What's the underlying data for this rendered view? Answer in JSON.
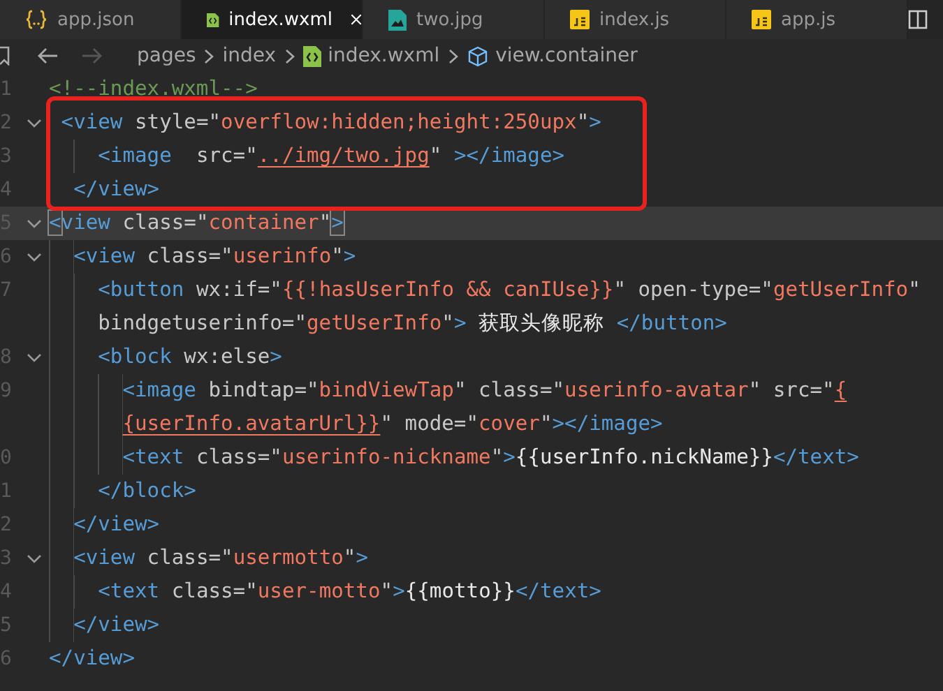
{
  "tabs": [
    {
      "label": "app.json",
      "kind": "json",
      "selected": false
    },
    {
      "label": "index.wxml",
      "kind": "wxml",
      "selected": true
    },
    {
      "label": "two.jpg",
      "kind": "image",
      "selected": false
    },
    {
      "label": "index.js",
      "kind": "js",
      "selected": false
    },
    {
      "label": "app.js",
      "kind": "js",
      "selected": false
    }
  ],
  "breadcrumb": [
    {
      "label": "pages",
      "kind": "folder"
    },
    {
      "label": "index",
      "kind": "folder"
    },
    {
      "label": "index.wxml",
      "kind": "wxml"
    },
    {
      "label": "view.container",
      "kind": "element"
    }
  ],
  "rows": [
    {
      "number": "1",
      "fold": false,
      "boxed": false,
      "current": false,
      "tokens": [
        {
          "kind": "c",
          "t": "<!--index.wxml-->"
        }
      ]
    },
    {
      "number": "2",
      "fold": true,
      "boxed": true,
      "current": false,
      "tokens": [
        {
          "kind": "t",
          "t": " <view"
        },
        {
          "kind": "a",
          "t": " style=\""
        },
        {
          "kind": "s",
          "t": "overflow:hidden;height:250upx"
        },
        {
          "kind": "a",
          "t": "\""
        },
        {
          "kind": "t",
          "t": ">"
        }
      ]
    },
    {
      "number": "3",
      "fold": false,
      "boxed": true,
      "current": false,
      "tokens": [
        {
          "kind": "t",
          "t": "    <image"
        },
        {
          "kind": "a",
          "t": "  src=\""
        },
        {
          "kind": "s",
          "t": "../img/two.jpg",
          "u": true
        },
        {
          "kind": "a",
          "t": "\" "
        },
        {
          "kind": "t",
          "t": "></image>"
        }
      ]
    },
    {
      "number": "4",
      "fold": false,
      "boxed": true,
      "current": false,
      "tokens": [
        {
          "kind": "t",
          "t": "  </view>"
        }
      ]
    },
    {
      "number": "5",
      "fold": true,
      "boxed": false,
      "current": true,
      "tokens": [
        {
          "kind": "t",
          "t": "<",
          "m": true
        },
        {
          "kind": "t",
          "t": "view"
        },
        {
          "kind": "a",
          "t": " class=\""
        },
        {
          "kind": "s",
          "t": "container"
        },
        {
          "kind": "a",
          "t": "\""
        },
        {
          "kind": "t",
          "t": ">",
          "m": true
        }
      ]
    },
    {
      "number": "6",
      "fold": true,
      "boxed": false,
      "current": false,
      "tokens": [
        {
          "kind": "t",
          "t": "  <view"
        },
        {
          "kind": "a",
          "t": " class=\""
        },
        {
          "kind": "s",
          "t": "userinfo"
        },
        {
          "kind": "a",
          "t": "\""
        },
        {
          "kind": "t",
          "t": ">"
        }
      ]
    },
    {
      "number": "7",
      "fold": false,
      "boxed": false,
      "current": false,
      "tokens": [
        {
          "kind": "t",
          "t": "    <button"
        },
        {
          "kind": "a",
          "t": " wx:if=\""
        },
        {
          "kind": "s",
          "t": "{{!hasUserInfo && canIUse}}"
        },
        {
          "kind": "a",
          "t": "\" open-type=\""
        },
        {
          "kind": "s",
          "t": "getUserInfo"
        },
        {
          "kind": "a",
          "t": "\""
        }
      ]
    },
    {
      "number": "",
      "fold": false,
      "boxed": false,
      "current": false,
      "tokens": [
        {
          "kind": "a",
          "t": "    bindgetuserinfo=\""
        },
        {
          "kind": "s",
          "t": "getUserInfo"
        },
        {
          "kind": "a",
          "t": "\""
        },
        {
          "kind": "t",
          "t": ">"
        },
        {
          "kind": "x",
          "t": " 获取头像昵称 "
        },
        {
          "kind": "t",
          "t": "</button>"
        }
      ]
    },
    {
      "number": "8",
      "fold": true,
      "boxed": false,
      "current": false,
      "tokens": [
        {
          "kind": "t",
          "t": "    <block"
        },
        {
          "kind": "a",
          "t": " wx:else"
        },
        {
          "kind": "t",
          "t": ">"
        }
      ]
    },
    {
      "number": "9",
      "fold": false,
      "boxed": false,
      "current": false,
      "tokens": [
        {
          "kind": "t",
          "t": "      <image"
        },
        {
          "kind": "a",
          "t": " bindtap=\""
        },
        {
          "kind": "s",
          "t": "bindViewTap"
        },
        {
          "kind": "a",
          "t": "\" class=\""
        },
        {
          "kind": "s",
          "t": "userinfo-avatar"
        },
        {
          "kind": "a",
          "t": "\" src=\""
        },
        {
          "kind": "s",
          "t": "{",
          "u": true
        }
      ]
    },
    {
      "number": "",
      "fold": false,
      "boxed": false,
      "current": false,
      "tokens": [
        {
          "kind": "s",
          "t": "      {userInfo.avatarUrl}}",
          "u": true
        },
        {
          "kind": "a",
          "t": "\" mode=\""
        },
        {
          "kind": "s",
          "t": "cover"
        },
        {
          "kind": "a",
          "t": "\""
        },
        {
          "kind": "t",
          "t": "></image>"
        }
      ]
    },
    {
      "number": "0",
      "fold": false,
      "boxed": false,
      "current": false,
      "tokens": [
        {
          "kind": "t",
          "t": "      <text"
        },
        {
          "kind": "a",
          "t": " class=\""
        },
        {
          "kind": "s",
          "t": "userinfo-nickname"
        },
        {
          "kind": "a",
          "t": "\""
        },
        {
          "kind": "t",
          "t": ">"
        },
        {
          "kind": "x",
          "t": "{{userInfo.nickName}}"
        },
        {
          "kind": "t",
          "t": "</text>"
        }
      ]
    },
    {
      "number": "1",
      "fold": false,
      "boxed": false,
      "current": false,
      "tokens": [
        {
          "kind": "t",
          "t": "    </block>"
        }
      ]
    },
    {
      "number": "2",
      "fold": false,
      "boxed": false,
      "current": false,
      "tokens": [
        {
          "kind": "t",
          "t": "  </view>"
        }
      ]
    },
    {
      "number": "3",
      "fold": true,
      "boxed": false,
      "current": false,
      "tokens": [
        {
          "kind": "t",
          "t": "  <view"
        },
        {
          "kind": "a",
          "t": " class=\""
        },
        {
          "kind": "s",
          "t": "usermotto"
        },
        {
          "kind": "a",
          "t": "\""
        },
        {
          "kind": "t",
          "t": ">"
        }
      ]
    },
    {
      "number": "4",
      "fold": false,
      "boxed": false,
      "current": false,
      "tokens": [
        {
          "kind": "t",
          "t": "    <text"
        },
        {
          "kind": "a",
          "t": " class=\""
        },
        {
          "kind": "s",
          "t": "user-motto"
        },
        {
          "kind": "a",
          "t": "\""
        },
        {
          "kind": "t",
          "t": ">"
        },
        {
          "kind": "x",
          "t": "{{motto}}"
        },
        {
          "kind": "t",
          "t": "</text>"
        }
      ]
    },
    {
      "number": "5",
      "fold": false,
      "boxed": false,
      "current": false,
      "tokens": [
        {
          "kind": "t",
          "t": "  </view>"
        }
      ]
    },
    {
      "number": "6",
      "fold": false,
      "boxed": false,
      "current": false,
      "tokens": [
        {
          "kind": "t",
          "t": "</view>"
        }
      ]
    }
  ]
}
